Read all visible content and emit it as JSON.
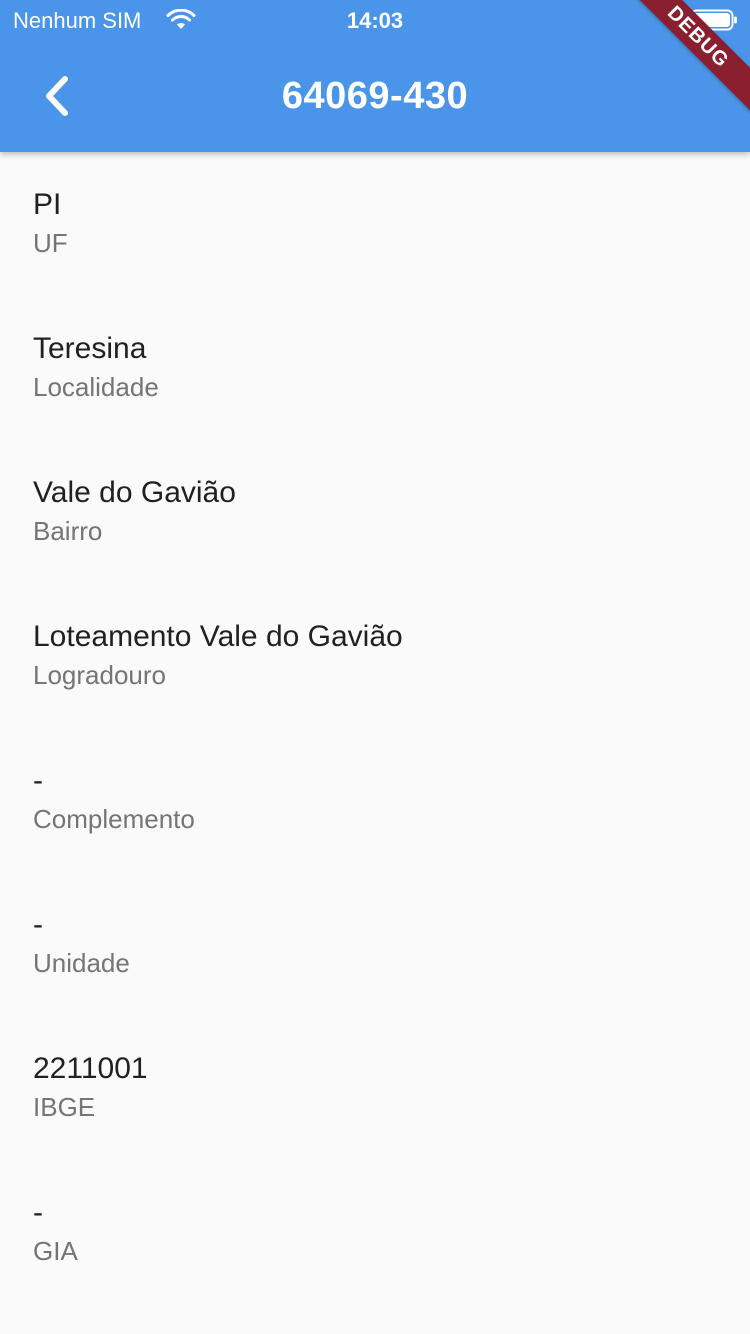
{
  "status_bar": {
    "carrier": "Nenhum SIM",
    "time": "14:03",
    "wifi_icon": "wifi-icon",
    "battery_icon": "battery-icon"
  },
  "app_bar": {
    "title": "64069-430",
    "back_icon": "chevron-left-icon",
    "background_color": "#4a95e9",
    "debug_label": "DEBUG"
  },
  "fields": [
    {
      "value": "PI",
      "label": "UF"
    },
    {
      "value": "Teresina",
      "label": "Localidade"
    },
    {
      "value": "Vale do Gavião",
      "label": "Bairro"
    },
    {
      "value": "Loteamento Vale do Gavião",
      "label": "Logradouro"
    },
    {
      "value": "-",
      "label": "Complemento"
    },
    {
      "value": "-",
      "label": "Unidade"
    },
    {
      "value": "2211001",
      "label": "IBGE"
    },
    {
      "value": "-",
      "label": "GIA"
    }
  ]
}
